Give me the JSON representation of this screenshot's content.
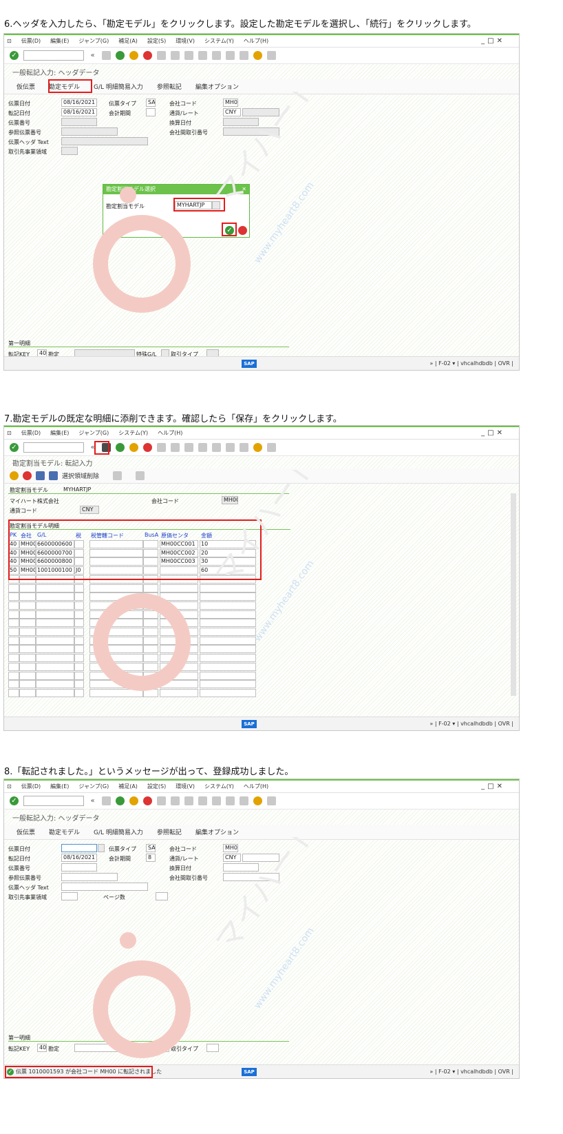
{
  "captions": [
    "6.ヘッダを入力したら、「勘定モデル」をクリックします。設定した勘定モデルを選択し、「続行」をクリックします。",
    "7.勘定モデルの既定な明細に添削できます。確認したら「保存」をクリックします。",
    "8.「転記されました。」というメッセージが出って、登録成功しました。"
  ],
  "menu": [
    "伝票(D)",
    "編集(E)",
    "ジャンプ(G)",
    "補足(A)",
    "設定(S)",
    "環境(V)",
    "システム(Y)",
    "ヘルプ(H)"
  ],
  "menu2": [
    "伝票(D)",
    "編集(E)",
    "ジャンプ(G)",
    "システム(Y)",
    "ヘルプ(H)"
  ],
  "status_info": "» | F-02 ▾ | vhcalhdbdb | OVR | ",
  "sap_logo": "SAP",
  "watermark": {
    "main": "マイハート株式会社",
    "sub": "MY HEART",
    "url": "www.myheart8.com"
  },
  "screen1": {
    "title": "一般転記入力: ヘッダデータ",
    "app_toolbar": [
      "仮伝票",
      "勘定モデル",
      "G/L 明細簡易入力",
      "参照転記",
      "編集オプション"
    ],
    "fields": {
      "doc_date_label": "伝票日付",
      "doc_date": "08/16/2021",
      "doc_type_label": "伝票タイプ",
      "doc_type": "SA",
      "company_label": "会社コード",
      "company": "MH00",
      "posting_date_label": "転記日付",
      "posting_date": "08/16/2021",
      "period_label": "会計期間",
      "period": "",
      "currency_label": "通貨/レート",
      "currency": "CNY",
      "doc_no_label": "伝票番号",
      "translation_label": "換算日付",
      "reference_label": "参照伝票番号",
      "intercompany_label": "会社間取引番号",
      "header_text_label": "伝票ヘッダ Text",
      "trading_partner_label": "取引先事業領域"
    },
    "dialog": {
      "title": "勘定割当モデル選択",
      "label": "勘定割当モデル",
      "value": "MYHARTJP"
    },
    "first_item": {
      "section": "第一明細",
      "posting_key_label": "転記KEY",
      "posting_key": "40",
      "account_label": "勘定",
      "special_gl_label": "特殊G/L",
      "txn_type_label": "取引タイプ"
    }
  },
  "screen2": {
    "title": "勘定割当モデル: 転記入力",
    "app_toolbar": [
      "選択領域削除"
    ],
    "header": {
      "model_label": "勘定割当モデル",
      "model": "MYHARTJP",
      "company_name": "マイハート株式会社",
      "company_label": "会社コード",
      "company": "MH00",
      "currency_label": "通貨コード",
      "currency": "CNY"
    },
    "items_section": "勘定割当モデル明細",
    "columns": [
      "PK",
      "会社",
      "G/L",
      "税",
      "税管轄コード",
      "BusA",
      "原価センタ",
      "金額"
    ],
    "rows": [
      [
        "40",
        "MH00",
        "6600000600",
        "",
        "",
        "",
        "MH00CC001",
        "10"
      ],
      [
        "40",
        "MH00",
        "6600000700",
        "",
        "",
        "",
        "MH00CC002",
        "20"
      ],
      [
        "40",
        "MH00",
        "6600000800",
        "",
        "",
        "",
        "MH00CC003",
        "30"
      ],
      [
        "50",
        "MH00",
        "1001000100",
        "J0",
        "",
        "",
        "",
        "60"
      ]
    ]
  },
  "screen3": {
    "title": "一般転記入力: ヘッダデータ",
    "app_toolbar": [
      "仮伝票",
      "勘定モデル",
      "G/L 明細簡易入力",
      "参照転記",
      "編集オプション"
    ],
    "fields": {
      "doc_date_label": "伝票日付",
      "doc_date": "",
      "doc_type_label": "伝票タイプ",
      "doc_type": "SA",
      "company_label": "会社コード",
      "company": "MH00",
      "posting_date_label": "転記日付",
      "posting_date": "08/16/2021",
      "period_label": "会計期間",
      "period": "8",
      "currency_label": "通貨/レート",
      "currency": "CNY",
      "doc_no_label": "伝票番号",
      "translation_label": "換算日付",
      "reference_label": "参照伝票番号",
      "intercompany_label": "会社間取引番号",
      "header_text_label": "伝票ヘッダ Text",
      "trading_partner_label": "取引先事業領域",
      "page_count_label": "ページ数"
    },
    "first_item": {
      "section": "第一明細",
      "posting_key_label": "転記KEY",
      "posting_key": "40",
      "account_label": "勘定",
      "special_gl_label": "特殊G/L",
      "txn_type_label": "取引タイプ"
    },
    "message": "伝票 1010001593 が会社コード MH00 に転記されました"
  },
  "colors": {
    "accent": "#6cc24a",
    "highlight": "#e31b1b",
    "sap_blue": "#1a6fd6"
  }
}
